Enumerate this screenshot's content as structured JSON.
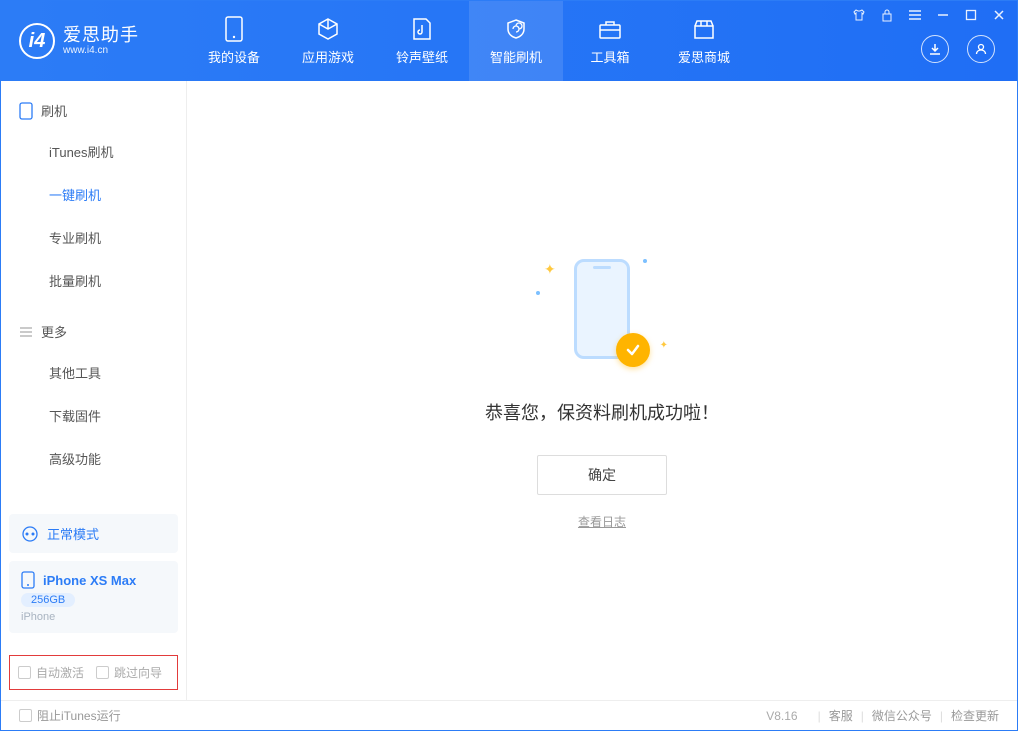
{
  "logo": {
    "title": "爱思助手",
    "subtitle": "www.i4.cn"
  },
  "nav": {
    "items": [
      {
        "label": "我的设备"
      },
      {
        "label": "应用游戏"
      },
      {
        "label": "铃声壁纸"
      },
      {
        "label": "智能刷机"
      },
      {
        "label": "工具箱"
      },
      {
        "label": "爱思商城"
      }
    ]
  },
  "sidebar": {
    "section1_title": "刷机",
    "section1_items": [
      {
        "label": "iTunes刷机"
      },
      {
        "label": "一键刷机"
      },
      {
        "label": "专业刷机"
      },
      {
        "label": "批量刷机"
      }
    ],
    "section2_title": "更多",
    "section2_items": [
      {
        "label": "其他工具"
      },
      {
        "label": "下载固件"
      },
      {
        "label": "高级功能"
      }
    ]
  },
  "device": {
    "mode_label": "正常模式",
    "name": "iPhone XS Max",
    "storage": "256GB",
    "type": "iPhone"
  },
  "options": {
    "auto_activate": "自动激活",
    "skip_guide": "跳过向导"
  },
  "main": {
    "success_text": "恭喜您，保资料刷机成功啦！",
    "ok_button": "确定",
    "view_log": "查看日志"
  },
  "footer": {
    "block_itunes": "阻止iTunes运行",
    "version": "V8.16",
    "support": "客服",
    "wechat": "微信公众号",
    "update": "检查更新"
  }
}
